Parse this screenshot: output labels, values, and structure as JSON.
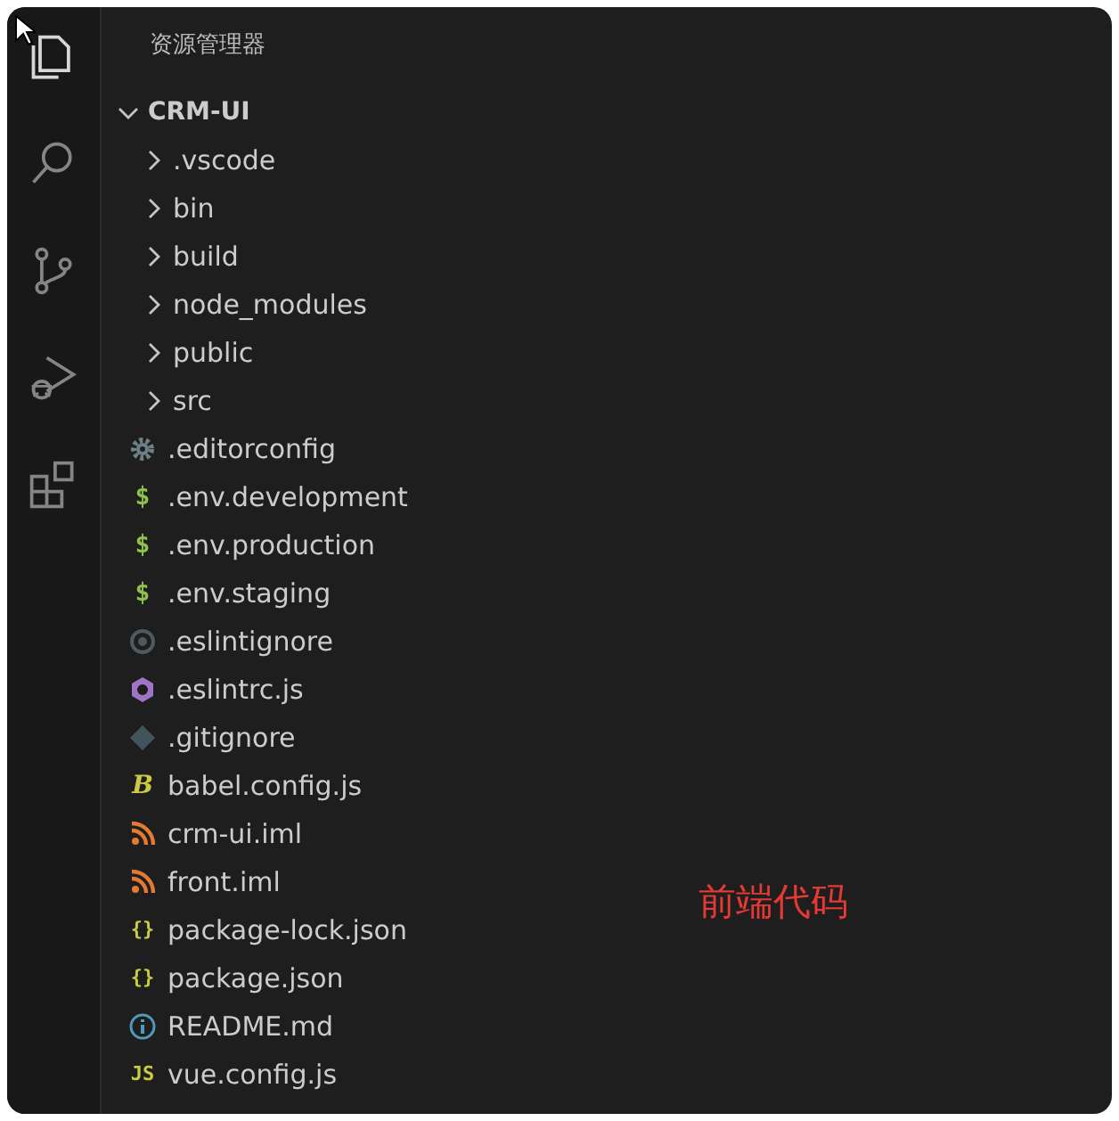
{
  "activity_bar": [
    {
      "kind": "files",
      "selected": true
    },
    {
      "kind": "search",
      "selected": false
    },
    {
      "kind": "source-control",
      "selected": false
    },
    {
      "kind": "run-debug",
      "selected": false
    },
    {
      "kind": "extensions",
      "selected": false
    }
  ],
  "explorer": {
    "title": "资源管理器",
    "root": {
      "label": "CRM-UI",
      "expanded": true,
      "children": [
        {
          "kind": "folder",
          "label": ".vscode",
          "expanded": false
        },
        {
          "kind": "folder",
          "label": "bin",
          "expanded": false
        },
        {
          "kind": "folder",
          "label": "build",
          "expanded": false
        },
        {
          "kind": "folder",
          "label": "node_modules",
          "expanded": false
        },
        {
          "kind": "folder",
          "label": "public",
          "expanded": false
        },
        {
          "kind": "folder",
          "label": "src",
          "expanded": false
        },
        {
          "kind": "gear",
          "color": "#6d8086",
          "label": ".editorconfig"
        },
        {
          "kind": "glyph",
          "glyph": "$",
          "color": "#8dc149",
          "label": ".env.development"
        },
        {
          "kind": "glyph",
          "glyph": "$",
          "color": "#8dc149",
          "label": ".env.production"
        },
        {
          "kind": "glyph",
          "glyph": "$",
          "color": "#8dc149",
          "label": ".env.staging"
        },
        {
          "kind": "target",
          "color": "#4d5a5e",
          "label": ".eslintignore"
        },
        {
          "kind": "hexagon",
          "color": "#a074c4",
          "label": ".eslintrc.js"
        },
        {
          "kind": "diamond",
          "color": "#41535b",
          "label": ".gitignore"
        },
        {
          "kind": "glyph",
          "glyph": "B",
          "color": "#cbcb41",
          "label": "babel.config.js"
        },
        {
          "kind": "feed",
          "color": "#e37933",
          "label": "crm-ui.iml"
        },
        {
          "kind": "feed",
          "color": "#e37933",
          "label": "front.iml"
        },
        {
          "kind": "glyph",
          "glyph": "{}",
          "color": "#cbcb41",
          "label": "package-lock.json"
        },
        {
          "kind": "glyph",
          "glyph": "{}",
          "color": "#cbcb41",
          "label": "package.json"
        },
        {
          "kind": "info",
          "color": "#519aba",
          "label": "README.md"
        },
        {
          "kind": "glyph",
          "glyph": "JS",
          "color": "#cbcb41",
          "label": "vue.config.js"
        }
      ]
    }
  },
  "annotation": "前端代码"
}
